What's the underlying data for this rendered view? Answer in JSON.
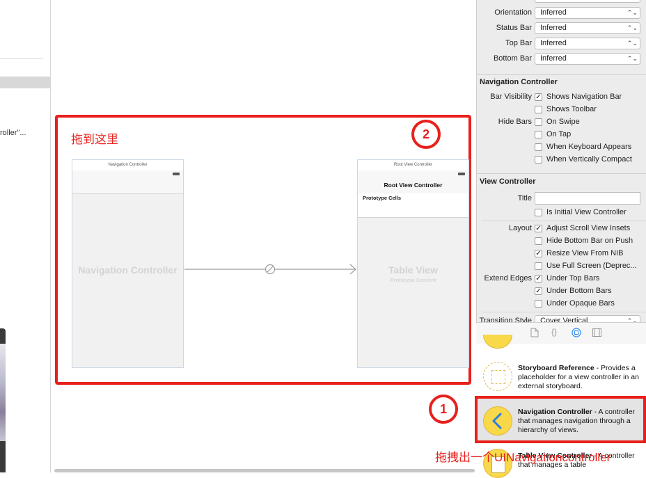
{
  "left_sidebar": {
    "partial_text": "roller\"..."
  },
  "canvas": {
    "annotation_drag_here": "拖到这里",
    "badge_2": "2",
    "badge_1": "1",
    "nav_scene": {
      "dock_title": "Navigation Controller",
      "center_label": "Navigation Controller"
    },
    "root_scene": {
      "dock_title": "Root View Controller",
      "nav_title": "Root View Controller",
      "prototype_cells": "Prototype Cells",
      "table_view_label": "Table View",
      "prototype_content": "Prototype Content"
    }
  },
  "inspector": {
    "simulated_metrics": [
      {
        "label": "Orientation",
        "value": "Inferred"
      },
      {
        "label": "Status Bar",
        "value": "Inferred"
      },
      {
        "label": "Top Bar",
        "value": "Inferred"
      },
      {
        "label": "Bottom Bar",
        "value": "Inferred"
      }
    ],
    "navigation_controller": {
      "title": "Navigation Controller",
      "bar_visibility_label": "Bar Visibility",
      "hide_bars_label": "Hide Bars",
      "options": [
        {
          "label": "Shows Navigation Bar",
          "checked": true
        },
        {
          "label": "Shows Toolbar",
          "checked": false
        },
        {
          "label": "On Swipe",
          "checked": false
        },
        {
          "label": "On Tap",
          "checked": false
        },
        {
          "label": "When Keyboard Appears",
          "checked": false
        },
        {
          "label": "When Vertically Compact",
          "checked": false
        }
      ]
    },
    "view_controller": {
      "title": "View Controller",
      "title_label": "Title",
      "title_value": "",
      "is_initial": {
        "label": "Is Initial View Controller",
        "checked": false
      },
      "layout_label": "Layout",
      "layout_options": [
        {
          "label": "Adjust Scroll View Insets",
          "checked": true
        },
        {
          "label": "Hide Bottom Bar on Push",
          "checked": false
        },
        {
          "label": "Resize View From NIB",
          "checked": true
        },
        {
          "label": "Use Full Screen (Deprec...",
          "checked": false
        }
      ],
      "extend_edges_label": "Extend Edges",
      "edge_options": [
        {
          "label": "Under Top Bars",
          "checked": true
        },
        {
          "label": "Under Bottom Bars",
          "checked": true
        },
        {
          "label": "Under Opaque Bars",
          "checked": false
        }
      ],
      "transition_style_label": "Transition Style",
      "transition_style_value": "Cover Vertical"
    }
  },
  "library": {
    "tab_icons": [
      "file-icon",
      "braces-icon",
      "object-icon",
      "media-icon"
    ],
    "items": [
      {
        "title": "Storyboard Reference",
        "description": "Provides a placeholder for a view controller in an external storyboard."
      },
      {
        "title": "Navigation Controller",
        "description": "A controller that manages navigation through a hierarchy of views."
      },
      {
        "title": "Table View Controller",
        "description": "A controller that manages a table"
      }
    ],
    "caption": "拖拽出一个UINavigationcontroller"
  },
  "colors": {
    "annotation_red": "#e8201c",
    "library_icon_yellow": "#f9d84a",
    "segue_line": "#9b9b9b"
  }
}
